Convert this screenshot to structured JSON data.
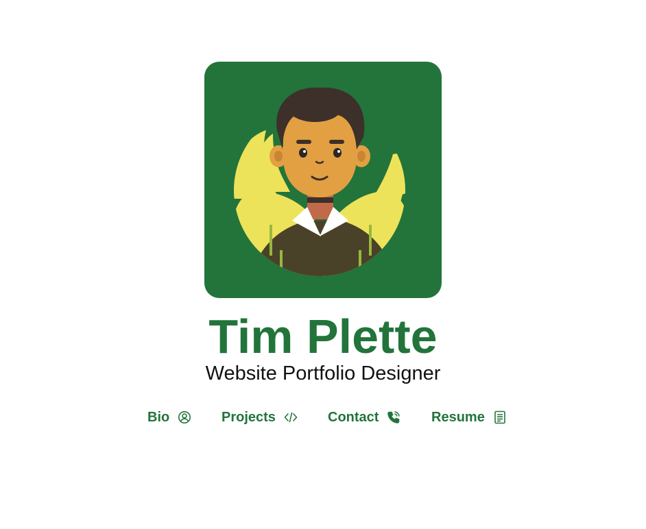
{
  "profile": {
    "name": "Tim Plette",
    "subtitle": "Website Portfolio Designer",
    "avatar_alt": "illustrated-avatar"
  },
  "nav": {
    "items": [
      {
        "label": "Bio",
        "icon": "user-circle-icon"
      },
      {
        "label": "Projects",
        "icon": "code-icon"
      },
      {
        "label": "Contact",
        "icon": "phone-call-icon"
      },
      {
        "label": "Resume",
        "icon": "document-icon"
      }
    ]
  },
  "colors": {
    "brand_green": "#22743b",
    "leaf_yellow": "#ede35a",
    "skin": "#e2a042",
    "hair": "#3d2f2a",
    "shirt": "#4a4129",
    "text_dark": "#111111"
  }
}
